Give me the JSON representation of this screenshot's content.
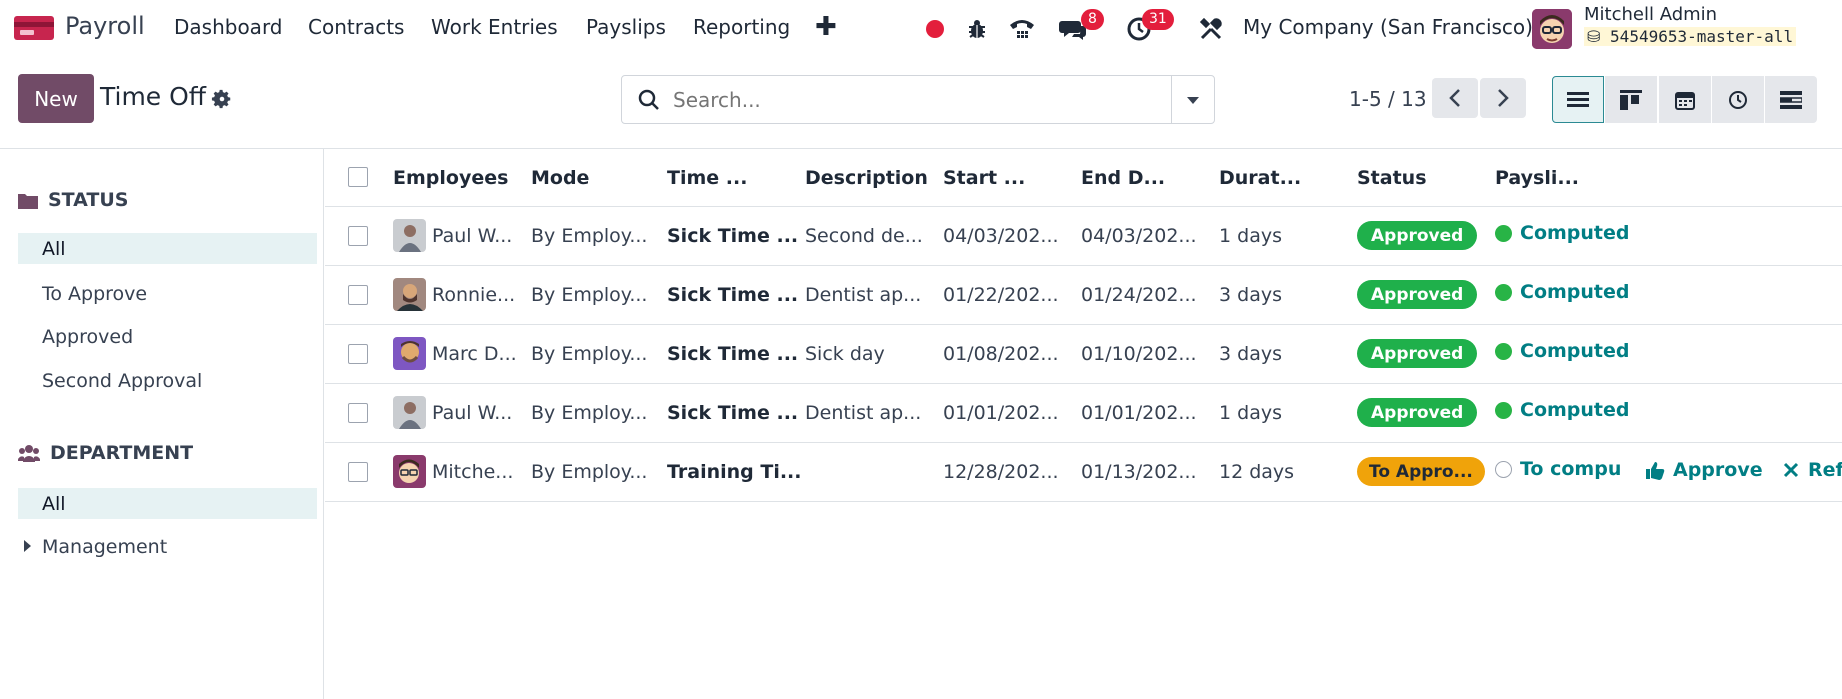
{
  "navbar": {
    "app_name": "Payroll",
    "menus": [
      "Dashboard",
      "Contracts",
      "Work Entries",
      "Payslips",
      "Reporting"
    ],
    "messages_count": "8",
    "activities_count": "31",
    "company": "My Company (San Francisco)",
    "user_name": "Mitchell Admin",
    "database": "54549653-master-all"
  },
  "control": {
    "new_label": "New",
    "title": "Time Off",
    "search_placeholder": "Search...",
    "pager": "1-5 / 13"
  },
  "sidebar": {
    "status_heading": "STATUS",
    "status_items": [
      "All",
      "To Approve",
      "Approved",
      "Second Approval"
    ],
    "department_heading": "DEPARTMENT",
    "department_items": [
      "All",
      "Management"
    ]
  },
  "table": {
    "columns": [
      "Employees",
      "Mode",
      "Time ...",
      "Description",
      "Start ...",
      "End D...",
      "Durat...",
      "Status",
      "Paysli..."
    ],
    "rows": [
      {
        "employee": "Paul W...",
        "mode": "By Employ...",
        "time_off_type": "Sick Time ...",
        "description": "Second de...",
        "start": "04/03/202...",
        "end": "04/03/202...",
        "duration": "1 days",
        "status": "Approved",
        "payslip": "Computed"
      },
      {
        "employee": "Ronnie...",
        "mode": "By Employ...",
        "time_off_type": "Sick Time ...",
        "description": "Dentist ap...",
        "start": "01/22/202...",
        "end": "01/24/202...",
        "duration": "3 days",
        "status": "Approved",
        "payslip": "Computed"
      },
      {
        "employee": "Marc D...",
        "mode": "By Employ...",
        "time_off_type": "Sick Time ...",
        "description": "Sick day",
        "start": "01/08/202...",
        "end": "01/10/202...",
        "duration": "3 days",
        "status": "Approved",
        "payslip": "Computed"
      },
      {
        "employee": "Paul W...",
        "mode": "By Employ...",
        "time_off_type": "Sick Time ...",
        "description": "Dentist ap...",
        "start": "01/01/202...",
        "end": "01/01/202...",
        "duration": "1 days",
        "status": "Approved",
        "payslip": "Computed"
      },
      {
        "employee": "Mitche...",
        "mode": "By Employ...",
        "time_off_type": "Training Ti...",
        "description": "",
        "start": "12/28/202...",
        "end": "01/13/202...",
        "duration": "12 days",
        "status": "To Appro...",
        "payslip": "To comput",
        "actions": {
          "approve": "Approve",
          "refuse": "Ref"
        }
      }
    ]
  },
  "colors": {
    "brand": "#714b67",
    "approved": "#1fb04b",
    "to_approve": "#f0a30a",
    "computed_dot": "#28b446",
    "link": "#017e84",
    "badge": "#e31e3c"
  }
}
